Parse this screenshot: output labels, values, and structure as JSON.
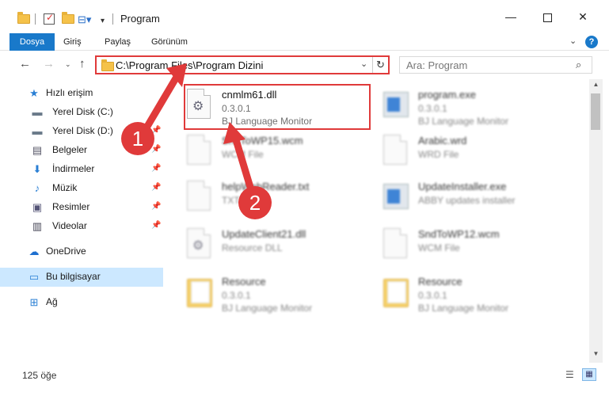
{
  "window": {
    "title": "Program",
    "minimize_glyph": "—",
    "close_glyph": "✕"
  },
  "quick_access_toolbar": {
    "icons": [
      "folder-icon",
      "properties-check-icon",
      "new-folder-icon",
      "properties-icon",
      "customize-dropdown-icon"
    ],
    "properties_glyph": "⊟▾",
    "customize_glyph": "▾"
  },
  "ribbon": {
    "tabs": [
      "Dosya",
      "Giriş",
      "Paylaş",
      "Görünüm"
    ],
    "expand_glyph": "⌄",
    "help_glyph": "?"
  },
  "nav": {
    "back_glyph": "←",
    "forward_glyph": "→",
    "recent_glyph": "⌄",
    "up_glyph": "↑"
  },
  "address": {
    "path": "C:\\Program Files\\Program Dizini",
    "dropdown_glyph": "⌄",
    "refresh_glyph": "↻"
  },
  "search": {
    "placeholder": "Ara: Program",
    "icon_glyph": "⌕"
  },
  "sidebar": {
    "items": [
      {
        "label": "Hızlı erişim",
        "icon": "star-icon",
        "glyph": "★"
      },
      {
        "label": "Yerel Disk (C:)",
        "icon": "drive-icon",
        "glyph": "▬",
        "pinned": true
      },
      {
        "label": "Yerel Disk (D:)",
        "icon": "drive-icon",
        "glyph": "▬",
        "pinned": true
      },
      {
        "label": "Belgeler",
        "icon": "documents-icon",
        "glyph": "▤",
        "pinned": true
      },
      {
        "label": "İndirmeler",
        "icon": "download-icon",
        "glyph": "⬇",
        "pinned": true
      },
      {
        "label": "Müzik",
        "icon": "music-icon",
        "glyph": "♪",
        "pinned": true
      },
      {
        "label": "Resimler",
        "icon": "pictures-icon",
        "glyph": "▣",
        "pinned": true
      },
      {
        "label": "Videolar",
        "icon": "videos-icon",
        "glyph": "▥",
        "pinned": true
      },
      {
        "label": "OneDrive",
        "icon": "cloud-icon",
        "glyph": "☁"
      },
      {
        "label": "Bu bilgisayar",
        "icon": "computer-icon",
        "glyph": "▭"
      },
      {
        "label": "Ağ",
        "icon": "network-icon",
        "glyph": "⊞"
      }
    ],
    "pin_glyph": "📌"
  },
  "files": [
    {
      "name": "cnmlm61.dll",
      "line1": "0.3.0.1",
      "line2": "BJ Language Monitor",
      "icon": "dll-file-icon"
    },
    {
      "name": "program.exe",
      "line1": "0.3.0.1",
      "line2": "BJ Language Monitor",
      "icon": "exe-file-icon"
    },
    {
      "name": "SndToWP15.wcm",
      "line1": "WCM File",
      "line2": "",
      "icon": "blank-file-icon"
    },
    {
      "name": "Arabic.wrd",
      "line1": "WRD File",
      "line2": "",
      "icon": "blank-file-icon"
    },
    {
      "name": "helpWebReader.txt",
      "line1": "TXT File",
      "line2": "",
      "icon": "text-file-icon"
    },
    {
      "name": "UpdateInstaller.exe",
      "line1": "ABBY updates installer",
      "line2": "",
      "icon": "exe-file-icon"
    },
    {
      "name": "UpdateClient21.dll",
      "line1": "Resource DLL",
      "line2": "",
      "icon": "dll-file-icon"
    },
    {
      "name": "SndToWP12.wcm",
      "line1": "WCM File",
      "line2": "",
      "icon": "blank-file-icon"
    },
    {
      "name": "Resource",
      "line1": "0.3.0.1",
      "line2": "BJ Language Monitor",
      "icon": "folder-doc-icon"
    },
    {
      "name": "Resource",
      "line1": "0.3.0.1",
      "line2": "BJ Language Monitor",
      "icon": "folder-doc-icon"
    }
  ],
  "annotations": {
    "badge1": "1",
    "badge2": "2",
    "color": "#e03a3a"
  },
  "scrollbar": {
    "up_glyph": "▲",
    "down_glyph": "▼"
  },
  "status": {
    "count": "125 öğe",
    "details_glyph": "☰",
    "tiles_glyph": "▦"
  },
  "colors": {
    "accent": "#1979ca",
    "selection": "#cce8ff",
    "highlight_red": "#e03a3a"
  }
}
